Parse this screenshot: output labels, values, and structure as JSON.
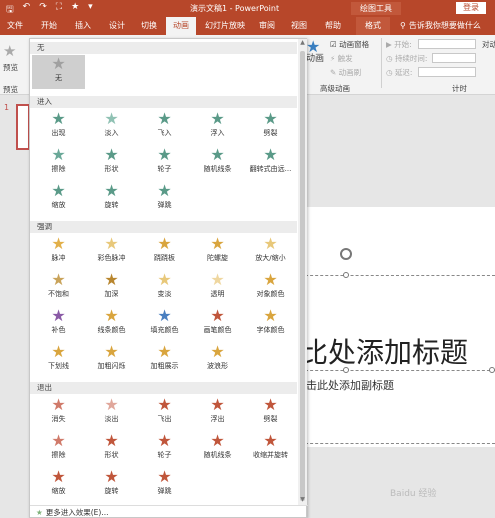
{
  "titlebar": {
    "qat": [
      "🖫",
      "↶",
      "↷",
      "⛶",
      "★",
      "▾"
    ],
    "title": "演示文稿1 - PowerPoint",
    "context": "绘图工具",
    "login": "登录"
  },
  "tabs": [
    "文件",
    "开始",
    "插入",
    "设计",
    "切换",
    "动画",
    "幻灯片放映",
    "审阅",
    "视图",
    "帮助",
    "格式"
  ],
  "tellme": "告诉我你想要做什么",
  "ribbon": {
    "preview": "预览",
    "preview_group": "预览",
    "add_animation": "动画",
    "animation_pane": "动画窗格",
    "trigger": "触发",
    "animation_painter": "动画刷",
    "advanced_group": "高级动画",
    "start": "开始:",
    "duration": "持续时间:",
    "delay": "延迟:",
    "timing_group": "计时",
    "reorder": "对动"
  },
  "panel": {
    "sections": {
      "none": "无",
      "entrance": "进入",
      "emphasis": "强调",
      "exit": "退出"
    },
    "none_items": [
      {
        "label": "无",
        "icon": "★",
        "color": "#a0a0a0"
      }
    ],
    "entrance_items": [
      {
        "label": "出现",
        "icon": "★",
        "color": "#5a9a88"
      },
      {
        "label": "淡入",
        "icon": "★",
        "color": "#8fc1b3"
      },
      {
        "label": "飞入",
        "icon": "★",
        "color": "#5a9a88"
      },
      {
        "label": "浮入",
        "icon": "★",
        "color": "#5a9a88"
      },
      {
        "label": "劈裂",
        "icon": "★",
        "color": "#5a9a88"
      },
      {
        "label": "擦除",
        "icon": "★",
        "color": "#6aa898"
      },
      {
        "label": "形状",
        "icon": "★",
        "color": "#5a9a88"
      },
      {
        "label": "轮子",
        "icon": "★",
        "color": "#5a9a88"
      },
      {
        "label": "随机线条",
        "icon": "★",
        "color": "#5a9a88"
      },
      {
        "label": "翻转式由远...",
        "icon": "★",
        "color": "#5a9a88"
      },
      {
        "label": "缩放",
        "icon": "★",
        "color": "#5a9a88"
      },
      {
        "label": "旋转",
        "icon": "★",
        "color": "#5a9a88"
      },
      {
        "label": "弹跳",
        "icon": "★",
        "color": "#5a9a88"
      }
    ],
    "emphasis_items": [
      {
        "label": "脉冲",
        "icon": "★",
        "color": "#e2b04a"
      },
      {
        "label": "彩色脉冲",
        "icon": "★",
        "color": "#e8c87a"
      },
      {
        "label": "跷跷板",
        "icon": "★",
        "color": "#d9a53e"
      },
      {
        "label": "陀螺旋",
        "icon": "★",
        "color": "#d9a53e"
      },
      {
        "label": "放大/缩小",
        "icon": "★",
        "color": "#e8c87a"
      },
      {
        "label": "不饱和",
        "icon": "★",
        "color": "#c9a35a"
      },
      {
        "label": "加深",
        "icon": "★",
        "color": "#b8862e"
      },
      {
        "label": "变淡",
        "icon": "★",
        "color": "#e8c87a"
      },
      {
        "label": "透明",
        "icon": "★",
        "color": "#efd7a0"
      },
      {
        "label": "对象颜色",
        "icon": "★",
        "color": "#d9a53e"
      },
      {
        "label": "补色",
        "icon": "★",
        "color": "#8a5aa6"
      },
      {
        "label": "线条颜色",
        "icon": "★",
        "color": "#d9a53e"
      },
      {
        "label": "填充颜色",
        "icon": "★",
        "color": "#4a7fc0"
      },
      {
        "label": "画笔颜色",
        "icon": "★",
        "color": "#c0563b"
      },
      {
        "label": "字体颜色",
        "icon": "★",
        "color": "#d9a53e"
      },
      {
        "label": "下划线",
        "icon": "★",
        "color": "#d9a53e"
      },
      {
        "label": "加粗闪烁",
        "icon": "★",
        "color": "#d9a53e"
      },
      {
        "label": "加粗展示",
        "icon": "★",
        "color": "#d9a53e"
      },
      {
        "label": "波浪形",
        "icon": "★",
        "color": "#d9a53e"
      }
    ],
    "exit_items": [
      {
        "label": "消失",
        "icon": "★",
        "color": "#d07a6a"
      },
      {
        "label": "淡出",
        "icon": "★",
        "color": "#e0a79b"
      },
      {
        "label": "飞出",
        "icon": "★",
        "color": "#c0563b"
      },
      {
        "label": "浮出",
        "icon": "★",
        "color": "#c0563b"
      },
      {
        "label": "劈裂",
        "icon": "★",
        "color": "#c0563b"
      },
      {
        "label": "擦除",
        "icon": "★",
        "color": "#d07a6a"
      },
      {
        "label": "形状",
        "icon": "★",
        "color": "#c0563b"
      },
      {
        "label": "轮子",
        "icon": "★",
        "color": "#c0563b"
      },
      {
        "label": "随机线条",
        "icon": "★",
        "color": "#c0563b"
      },
      {
        "label": "收缩并旋转",
        "icon": "★",
        "color": "#c0563b"
      },
      {
        "label": "缩放",
        "icon": "★",
        "color": "#c0563b"
      },
      {
        "label": "旋转",
        "icon": "★",
        "color": "#c0563b"
      },
      {
        "label": "弹跳",
        "icon": "★",
        "color": "#c0563b"
      }
    ],
    "more": "更多进入效果(E)..."
  },
  "slide": {
    "thumb_number": "1",
    "title": "比处添加标题",
    "subtitle": "击此处添加副标题"
  },
  "watermark": "Baidu 经验"
}
